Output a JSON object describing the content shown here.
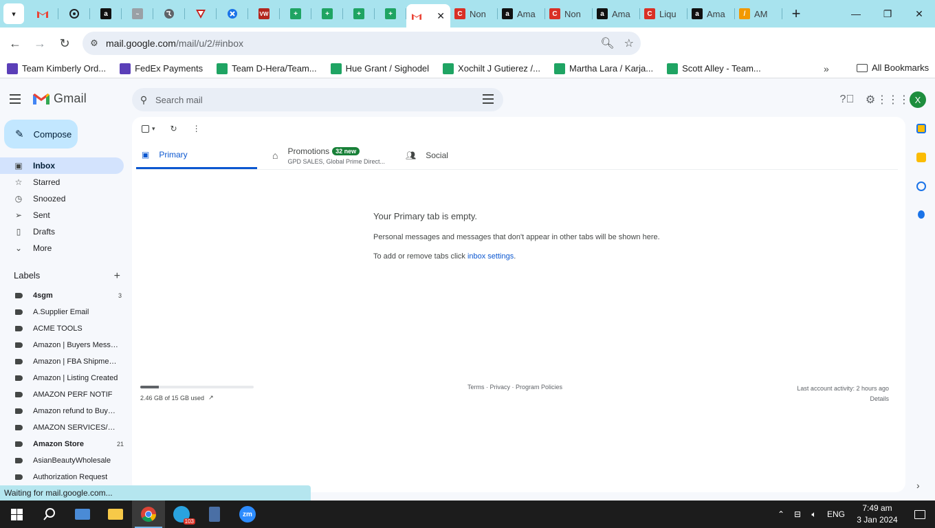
{
  "browser": {
    "tabs": [
      {
        "title": "",
        "icon": "gmail-favicon"
      },
      {
        "title": "",
        "icon": "openai-favicon"
      },
      {
        "title": "",
        "icon": "amazon-favicon"
      },
      {
        "title": "",
        "icon": "link-favicon"
      },
      {
        "title": "",
        "icon": "globe-favicon"
      },
      {
        "title": "",
        "icon": "shield-favicon"
      },
      {
        "title": "",
        "icon": "compass-favicon"
      },
      {
        "title": "",
        "icon": "vw-favicon"
      },
      {
        "title": "",
        "icon": "sheets-favicon"
      },
      {
        "title": "",
        "icon": "sheets-favicon"
      },
      {
        "title": "",
        "icon": "sheets-favicon"
      },
      {
        "title": "",
        "icon": "sheets-favicon"
      }
    ],
    "active_tab_icon": "gmail-favicon",
    "titled_tabs": [
      {
        "title": "Non",
        "icon": "c-favicon"
      },
      {
        "title": "Ama",
        "icon": "amazon-favicon"
      },
      {
        "title": "Non",
        "icon": "c-favicon"
      },
      {
        "title": "Ama",
        "icon": "amazon-favicon"
      },
      {
        "title": "Liqu",
        "icon": "c-favicon"
      },
      {
        "title": "Ama",
        "icon": "amazon-favicon"
      },
      {
        "title": "AM",
        "icon": "pen-favicon"
      }
    ],
    "url_host": "mail.google.com",
    "url_path": "/mail/u/2/#inbox",
    "bookmarks": [
      {
        "label": "Team Kimberly Ord...",
        "color": "purple"
      },
      {
        "label": "FedEx Payments",
        "color": "purple"
      },
      {
        "label": "Team D-Hera/Team...",
        "color": "green"
      },
      {
        "label": "Hue Grant / Sighodel",
        "color": "green"
      },
      {
        "label": "Xochilt J Gutierez /...",
        "color": "green"
      },
      {
        "label": "Martha Lara / Karja...",
        "color": "green"
      },
      {
        "label": "Scott Alley - Team...",
        "color": "green"
      }
    ],
    "all_bookmarks": "All Bookmarks",
    "status_text": "Waiting for mail.google.com..."
  },
  "gmail": {
    "app_name": "Gmail",
    "search_placeholder": "Search mail",
    "avatar_letter": "X",
    "compose_label": "Compose",
    "nav": [
      {
        "label": "Inbox",
        "icon": "inbox-icon",
        "active": true
      },
      {
        "label": "Starred",
        "icon": "star-icon"
      },
      {
        "label": "Snoozed",
        "icon": "clock-icon"
      },
      {
        "label": "Sent",
        "icon": "send-icon"
      },
      {
        "label": "Drafts",
        "icon": "draft-icon"
      },
      {
        "label": "More",
        "icon": "chevron-down-icon"
      }
    ],
    "labels_title": "Labels",
    "labels": [
      {
        "label": "4sgm",
        "count": "3",
        "bold": true
      },
      {
        "label": "A.Supplier Email",
        "count": ""
      },
      {
        "label": "ACME TOOLS",
        "count": ""
      },
      {
        "label": "Amazon | Buyers Messa...",
        "count": ""
      },
      {
        "label": "Amazon | FBA Shipments",
        "count": ""
      },
      {
        "label": "Amazon | Listing Created",
        "count": ""
      },
      {
        "label": "AMAZON PERF NOTIF",
        "count": ""
      },
      {
        "label": "Amazon refund to Buyers",
        "count": ""
      },
      {
        "label": "AMAZON SERVICES/PAY...",
        "count": ""
      },
      {
        "label": "Amazon Store",
        "count": "21",
        "bold": true
      },
      {
        "label": "AsianBeautyWholesale",
        "count": ""
      },
      {
        "label": "Authorization Request",
        "count": ""
      }
    ],
    "tabs": {
      "primary": "Primary",
      "promotions": "Promotions",
      "promotions_badge": "32 new",
      "promotions_sub": "GPD SALES, Global Prime Direct...",
      "social": "Social"
    },
    "empty": {
      "title": "Your Primary tab is empty.",
      "line1": "Personal messages and messages that don't appear in other tabs will be shown here.",
      "line2_prefix": "To add or remove tabs click ",
      "line2_link": "inbox settings",
      "line2_suffix": "."
    },
    "storage": {
      "text": "2.46 GB of 15 GB used",
      "used_fraction": 0.164
    },
    "footer": {
      "terms": "Terms",
      "privacy": "Privacy",
      "policies": "Program Policies",
      "sep": " · ",
      "activity": "Last account activity: 2 hours ago",
      "details": "Details"
    }
  },
  "taskbar": {
    "language": "ENG",
    "time": "7:49 am",
    "date": "3 Jan 2024",
    "telegram_badge": "103"
  }
}
